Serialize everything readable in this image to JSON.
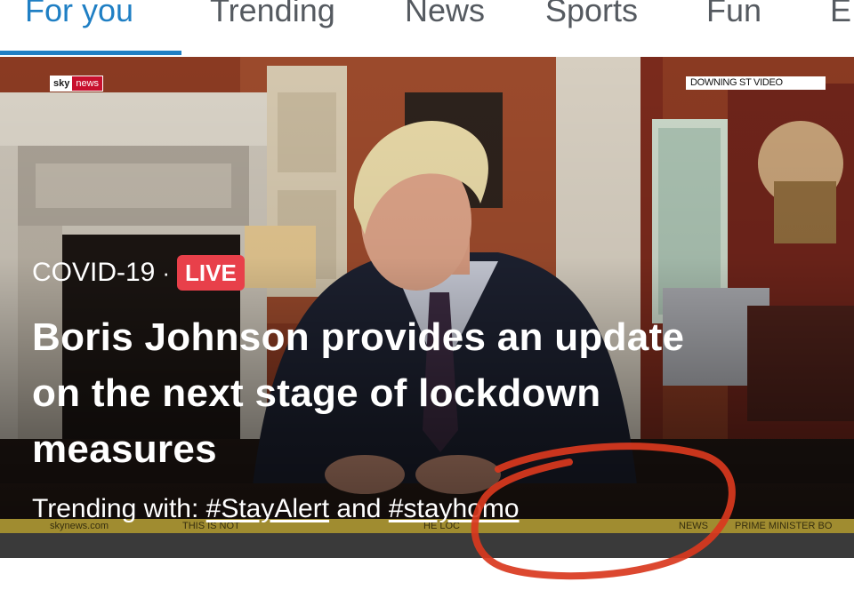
{
  "tabs": [
    {
      "label": "For you",
      "active": true
    },
    {
      "label": "Trending",
      "active": false
    },
    {
      "label": "News",
      "active": false
    },
    {
      "label": "Sports",
      "active": false
    },
    {
      "label": "Fun",
      "active": false
    },
    {
      "label": "E",
      "active": false
    }
  ],
  "colors": {
    "accent": "#1f7fc4",
    "live_badge": "#e8404a",
    "annotation_circle": "#d9381e",
    "ticker_bar": "#b9a337"
  },
  "broadcast": {
    "logo_sky": "sky",
    "logo_news": "news",
    "source_label": "DOWNING ST VIDEO"
  },
  "story": {
    "category": "COVID-19",
    "separator": "·",
    "live_badge": "LIVE",
    "headline": "Boris Johnson provides an update on the next stage of lockdown measures",
    "trending_prefix": "Trending with:",
    "tag1": "#StayAlert",
    "conjunction": "and",
    "tag2": "#stayhomo"
  },
  "ticker": {
    "site": "skynews.com",
    "segment1": "THIS IS NOT",
    "segment2": "HE LOC",
    "segment3": "NEWS",
    "segment4": "PRIME MINISTER BO"
  }
}
